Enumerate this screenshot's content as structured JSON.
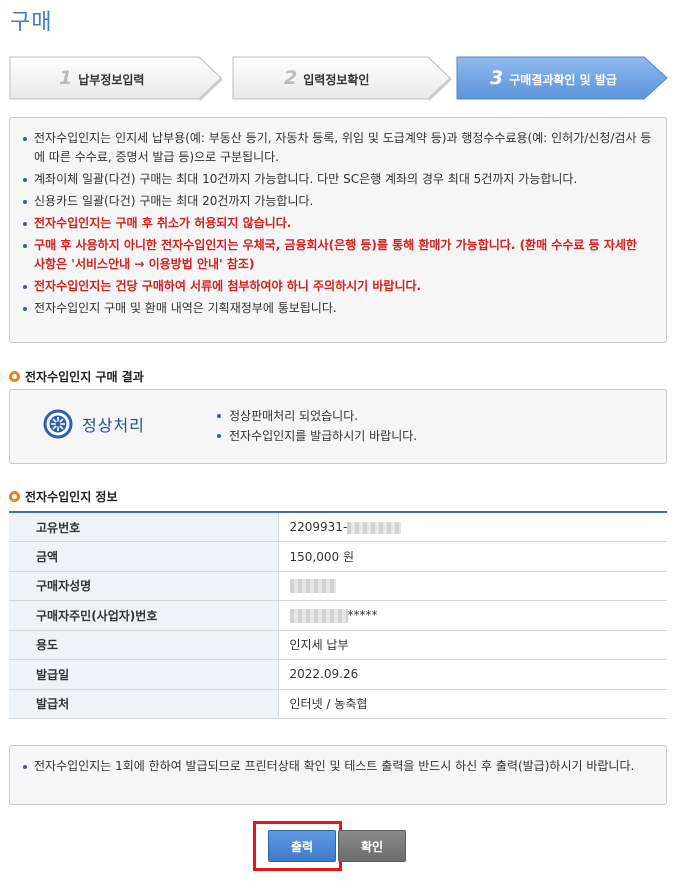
{
  "page": {
    "title": "구매"
  },
  "steps": [
    {
      "num": "1",
      "label": "납부정보입력",
      "active": false
    },
    {
      "num": "2",
      "label": "입력정보확인",
      "active": false
    },
    {
      "num": "3",
      "label": "구매결과확인 및 발급",
      "active": true
    }
  ],
  "notice": {
    "items": [
      {
        "text": "전자수입인지는 인지세 납부용(예: 부동산 등기, 자동차 등록, 위임 및 도급계약 등)과 행정수수료용(예: 인허가/신청/검사 등에 따른 수수료, 증명서 발급 등)으로 구분됩니다.",
        "red": false
      },
      {
        "text": "계좌이체 일괄(다건) 구매는 최대 10건까지 가능합니다. 다만 SC은행 계좌의 경우 최대 5건까지 가능합니다.",
        "red": false
      },
      {
        "text": "신용카드 일괄(다건) 구매는 최대 20건까지 가능합니다.",
        "red": false
      },
      {
        "text": "전자수입인지는 구매 후 취소가 허용되지 않습니다.",
        "red": true
      },
      {
        "text": "구매 후 사용하지 아니한 전자수입인지는 우체국, 금융회사(은행 등)를 통해 환매가 가능합니다. (환매 수수료 등 자세한 사항은 '서비스안내 → 이용방법 안내' 참조)",
        "red": true
      },
      {
        "text": "전자수입인지는 건당 구매하여 서류에 첨부하여야 하니 주의하시기 바랍니다.",
        "red": true
      },
      {
        "text": "전자수입인지 구매 및 환매 내역은 기획재정부에 통보됩니다.",
        "red": false
      }
    ]
  },
  "result_section": {
    "title": "전자수입인지 구매 결과",
    "status": "정상처리",
    "messages": [
      "정상판매처리 되었습니다.",
      "전자수입인지를 발급하시기 바랍니다."
    ]
  },
  "info_section": {
    "title": "전자수입인지 정보",
    "rows": [
      {
        "label": "고유번호",
        "value": "2209931-"
      },
      {
        "label": "금액",
        "value": "150,000 원"
      },
      {
        "label": "구매자성명",
        "value": ""
      },
      {
        "label": "구매자주민(사업자)번호",
        "value": "*****"
      },
      {
        "label": "용도",
        "value": "인지세 납부"
      },
      {
        "label": "발급일",
        "value": "2022.09.26"
      },
      {
        "label": "발급처",
        "value": "인터넷 / 농축협"
      }
    ]
  },
  "bottom_note": "전자수입인지는 1회에 한하여 발급되므로 프린터상태 확인 및 테스트 출력을 반드시 하신 후 출력(발급)하시기 바랍니다.",
  "buttons": {
    "print": "출력",
    "confirm": "확인"
  },
  "colors": {
    "accent": "#3d7cc9",
    "warning": "#d42121",
    "bullet": "#f07f1e",
    "highlight": "#e8141b"
  }
}
